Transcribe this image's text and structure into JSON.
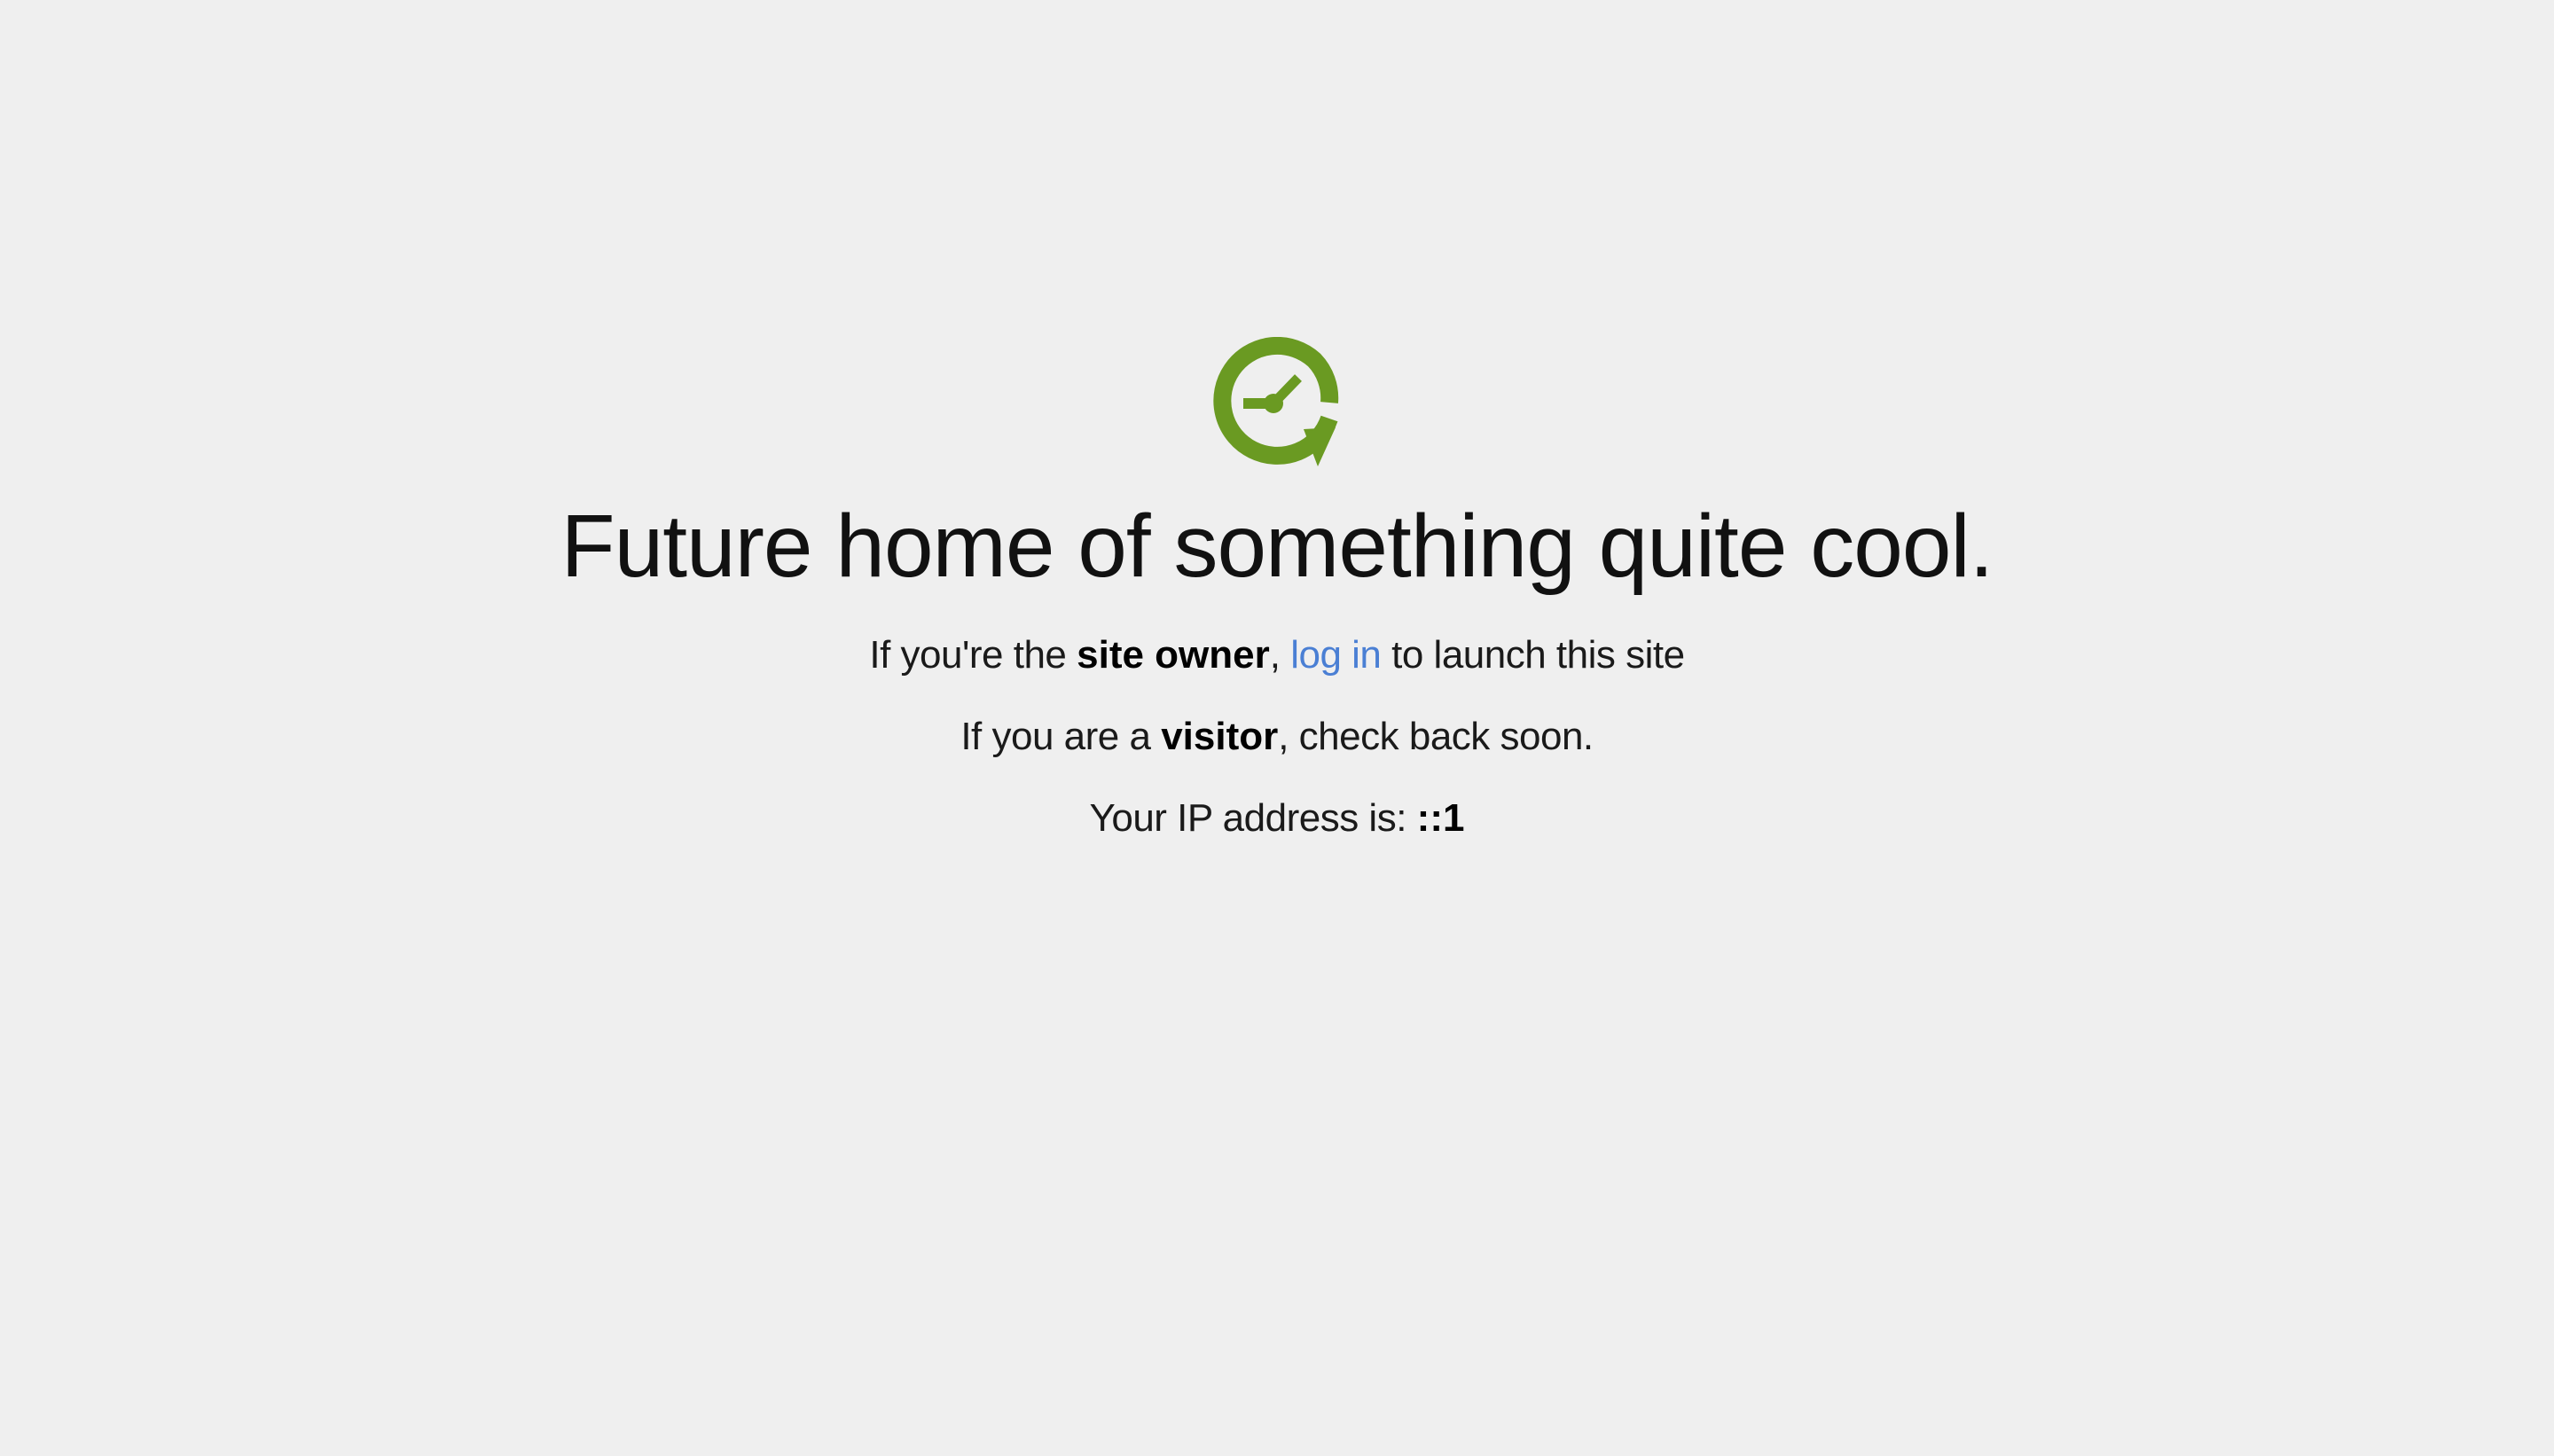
{
  "logo": {
    "icon": "clock-refresh-icon",
    "color": "#6a9a22"
  },
  "headline": "Future home of something quite cool.",
  "owner_line": {
    "prefix": "If you're the ",
    "bold": "site owner",
    "comma": ", ",
    "link": "log in",
    "suffix": " to launch this site"
  },
  "visitor_line": {
    "prefix": "If you are a ",
    "bold": "visitor",
    "suffix": ", check back soon."
  },
  "ip_line": {
    "prefix": "Your IP address is: ",
    "value": "::1"
  },
  "colors": {
    "background": "#efefef",
    "link": "#4a7fd4",
    "text": "#111111"
  }
}
